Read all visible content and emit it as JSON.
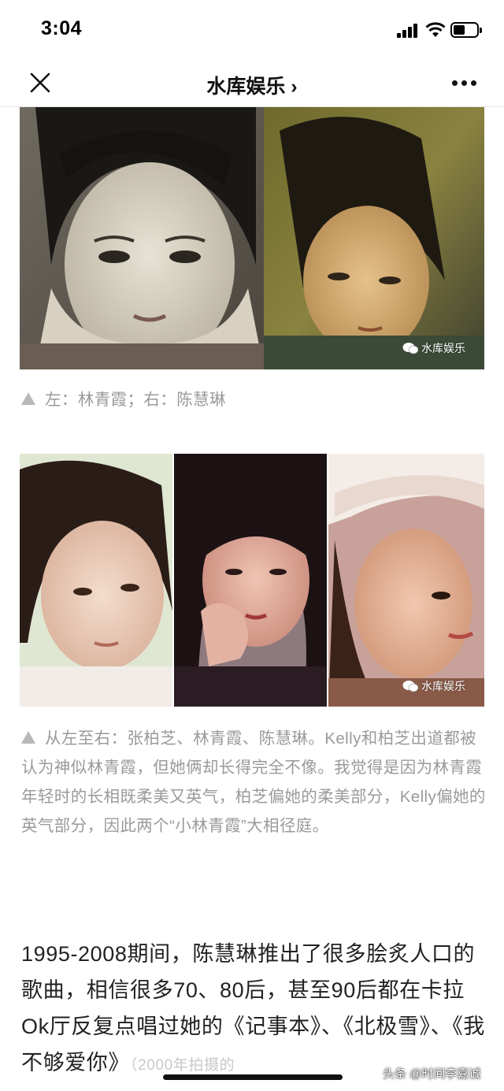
{
  "status_bar": {
    "time": "3:04",
    "battery_level": 0.4
  },
  "nav": {
    "title": "水库娱乐 ›",
    "close_icon": "close-icon",
    "more_icon": "more-icon"
  },
  "images": {
    "watermark": "水库娱乐",
    "caption1": "左：林青霞；右：陈慧琳",
    "caption2": "从左至右：张柏芝、林青霞、陈慧琳。Kelly和柏芝出道都被认为神似林青霞，但她俩却长得完全不像。我觉得是因为林青霞年轻时的长相既柔美又英气，柏芝偏她的柔美部分，Kelly偏她的英气部分，因此两个“小林青霞”大相径庭。"
  },
  "article": {
    "paragraph": "1995-2008期间，陈慧琳推出了很多脍炙人口的歌曲，相信很多70、80后，甚至90后都在卡拉Ok厅反复点唱过她的《记事本》、《北极雪》、《我不够爱你》",
    "paragraph_tail": "（2000年拍摄的"
  },
  "overlay": {
    "source_mark": "头条 @时间李嘉诚"
  },
  "colors": {
    "caption_gray": "#9a9a9a",
    "text": "#222222"
  }
}
